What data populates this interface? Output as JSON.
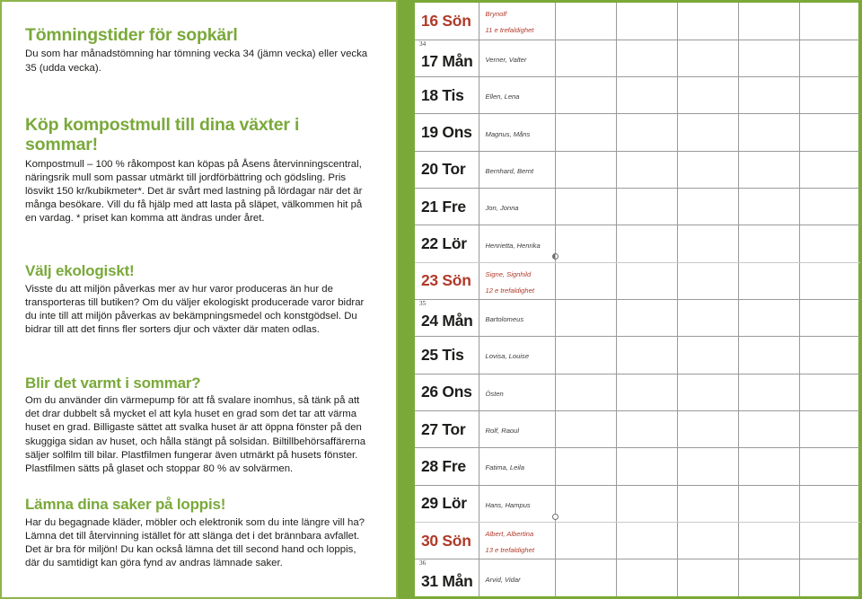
{
  "colors": {
    "green": "#7aa93a",
    "green_border": "#8fb54a",
    "sunday_red": "#b03a2a",
    "body_text": "#1d1d1b",
    "grid_line": "#9a9a99"
  },
  "left_panel": {
    "articles": [
      {
        "heading": "Tömningstider för sopkärl",
        "body": "Du som har månadstömning har tömning vecka 34 (jämn vecka) eller vecka 35 (udda vecka)."
      },
      {
        "heading": "Köp kompostmull till dina växter i sommar!",
        "body": "Kompostmull – 100 % råkompost kan köpas på Åsens återvinningscentral, näringsrik mull som passar utmärkt till jordförbättring och gödsling.\nPris lösvikt 150 kr/kubikmeter*. Det är svårt med lastning på lördagar när det är många besökare. Vill du få hjälp med att lasta på släpet, välkommen hit på en vardag.\n* priset kan komma att ändras under året."
      },
      {
        "heading": "Välj ekologiskt!",
        "body": "Visste du att miljön påverkas mer av hur varor produceras än hur de transporteras till butiken? Om du väljer ekologiskt producerade varor bidrar du inte till att miljön påverkas av bekämpningsmedel och konstgödsel. Du bidrar till att det finns fler sorters djur och växter där maten odlas."
      },
      {
        "heading": "Blir det varmt i sommar?",
        "body": "Om du använder din värmepump för att få svalare inomhus, så tänk på att det drar dubbelt så mycket el att kyla huset en grad som det tar att värma huset en grad. Billigaste sättet att svalka huset är att öppna fönster på den skuggiga sidan av huset, och hålla stängt på solsidan. Biltillbehörsaffärerna säljer solfilm till bilar. Plastfilmen fungerar även utmärkt på husets fönster. Plastfilmen sätts på glaset och stoppar 80 % av solvärmen."
      },
      {
        "heading": "Lämna dina saker på loppis!",
        "body": "Har du begagnade kläder, möbler och elektronik som du inte längre vill ha? Lämna det till återvinning istället för att slänga det i det brännbara avfallet. Det är bra för miljön! Du kan också lämna det till second hand och loppis, där du samtidigt kan göra fynd av andras lämnade saker."
      }
    ]
  },
  "calendar": {
    "rows": [
      {
        "day": "16",
        "weekday": "Sön",
        "date_label": "16 Sön",
        "names": "Brynolf\n11 e trefaldighet",
        "week": null,
        "sunday": true,
        "moon": null,
        "light_sep": false
      },
      {
        "day": "17",
        "weekday": "Mån",
        "date_label": "17 Mån",
        "names": "Verner, Valter",
        "week": "34",
        "sunday": false,
        "moon": null,
        "light_sep": false
      },
      {
        "day": "18",
        "weekday": "Tis",
        "date_label": "18 Tis",
        "names": "Ellen, Lena",
        "week": null,
        "sunday": false,
        "moon": null,
        "light_sep": false
      },
      {
        "day": "19",
        "weekday": "Ons",
        "date_label": "19 Ons",
        "names": "Magnus, Måns",
        "week": null,
        "sunday": false,
        "moon": null,
        "light_sep": false
      },
      {
        "day": "20",
        "weekday": "Tor",
        "date_label": "20 Tor",
        "names": "Bernhard, Bernt",
        "week": null,
        "sunday": false,
        "moon": null,
        "light_sep": false
      },
      {
        "day": "21",
        "weekday": "Fre",
        "date_label": "21 Fre",
        "names": "Jon, Jonna",
        "week": null,
        "sunday": false,
        "moon": null,
        "light_sep": false
      },
      {
        "day": "22",
        "weekday": "Lör",
        "date_label": "22 Lör",
        "names": "Henrietta, Henrika",
        "week": null,
        "sunday": false,
        "moon": "last-quarter",
        "light_sep": true
      },
      {
        "day": "23",
        "weekday": "Sön",
        "date_label": "23 Sön",
        "names": "Signe, Signhild\n12 e trefaldighet",
        "week": null,
        "sunday": true,
        "moon": null,
        "light_sep": false
      },
      {
        "day": "24",
        "weekday": "Mån",
        "date_label": "24 Mån",
        "names": "Bartolomeus",
        "week": "35",
        "sunday": false,
        "moon": null,
        "light_sep": false
      },
      {
        "day": "25",
        "weekday": "Tis",
        "date_label": "25 Tis",
        "names": "Lovisa, Louise",
        "week": null,
        "sunday": false,
        "moon": null,
        "light_sep": false
      },
      {
        "day": "26",
        "weekday": "Ons",
        "date_label": "26 Ons",
        "names": "Östen",
        "week": null,
        "sunday": false,
        "moon": null,
        "light_sep": false
      },
      {
        "day": "27",
        "weekday": "Tor",
        "date_label": "27 Tor",
        "names": "Rolf, Raoul",
        "week": null,
        "sunday": false,
        "moon": null,
        "light_sep": false
      },
      {
        "day": "28",
        "weekday": "Fre",
        "date_label": "28 Fre",
        "names": "Fatima, Leila",
        "week": null,
        "sunday": false,
        "moon": null,
        "light_sep": false
      },
      {
        "day": "29",
        "weekday": "Lör",
        "date_label": "29 Lör",
        "names": "Hans, Hampus",
        "week": null,
        "sunday": false,
        "moon": "new-moon",
        "light_sep": true
      },
      {
        "day": "30",
        "weekday": "Sön",
        "date_label": "30 Sön",
        "names": "Albert, Albertina\n13 e trefaldighet",
        "week": null,
        "sunday": true,
        "moon": null,
        "light_sep": false
      },
      {
        "day": "31",
        "weekday": "Mån",
        "date_label": "31 Mån",
        "names": "Arvid, Vidar",
        "week": "36",
        "sunday": false,
        "moon": null,
        "light_sep": false
      }
    ],
    "note_columns": 5
  }
}
